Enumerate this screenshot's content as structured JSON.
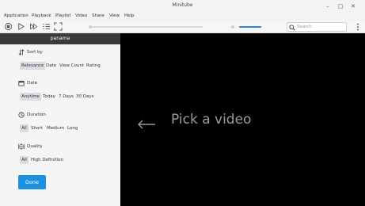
{
  "window": {
    "title": "Minitube",
    "minimize": "–",
    "maximize": "□",
    "close": "✕"
  },
  "menubar": {
    "items": [
      {
        "label": "Application"
      },
      {
        "label": "Playback"
      },
      {
        "label": "Playlist"
      },
      {
        "label": "Video"
      },
      {
        "label": "Share"
      },
      {
        "label": "View"
      },
      {
        "label": "Help"
      }
    ]
  },
  "toolbar": {
    "search_placeholder": "Search",
    "icons": [
      "stop-icon",
      "play-icon",
      "skip-icon",
      "playlist-icon",
      "fullscreen-icon",
      "search-icon",
      "more-icon"
    ]
  },
  "sidebar": {
    "header": "panama",
    "sections": {
      "sort": {
        "title": "Sort by",
        "options": [
          "Relevance",
          "Date",
          "View Count",
          "Rating"
        ],
        "selected": "Relevance"
      },
      "date": {
        "title": "Date",
        "options": [
          "Anytime",
          "Today",
          "7 Days",
          "30 Days"
        ],
        "selected": "Anytime"
      },
      "duration": {
        "title": "Duration",
        "options": [
          "All",
          "Short",
          "Medium",
          "Long"
        ],
        "selected": "All"
      },
      "quality": {
        "title": "Quality",
        "options": [
          "All",
          "High Definition"
        ],
        "selected": "All"
      }
    },
    "done_label": "Done"
  },
  "video": {
    "placeholder": "Pick a video"
  },
  "colors": {
    "accent": "#1e90e0",
    "sidebar_header": "#3a3a3a",
    "video_bg": "#000000",
    "selected_option": "#d9dde3"
  }
}
